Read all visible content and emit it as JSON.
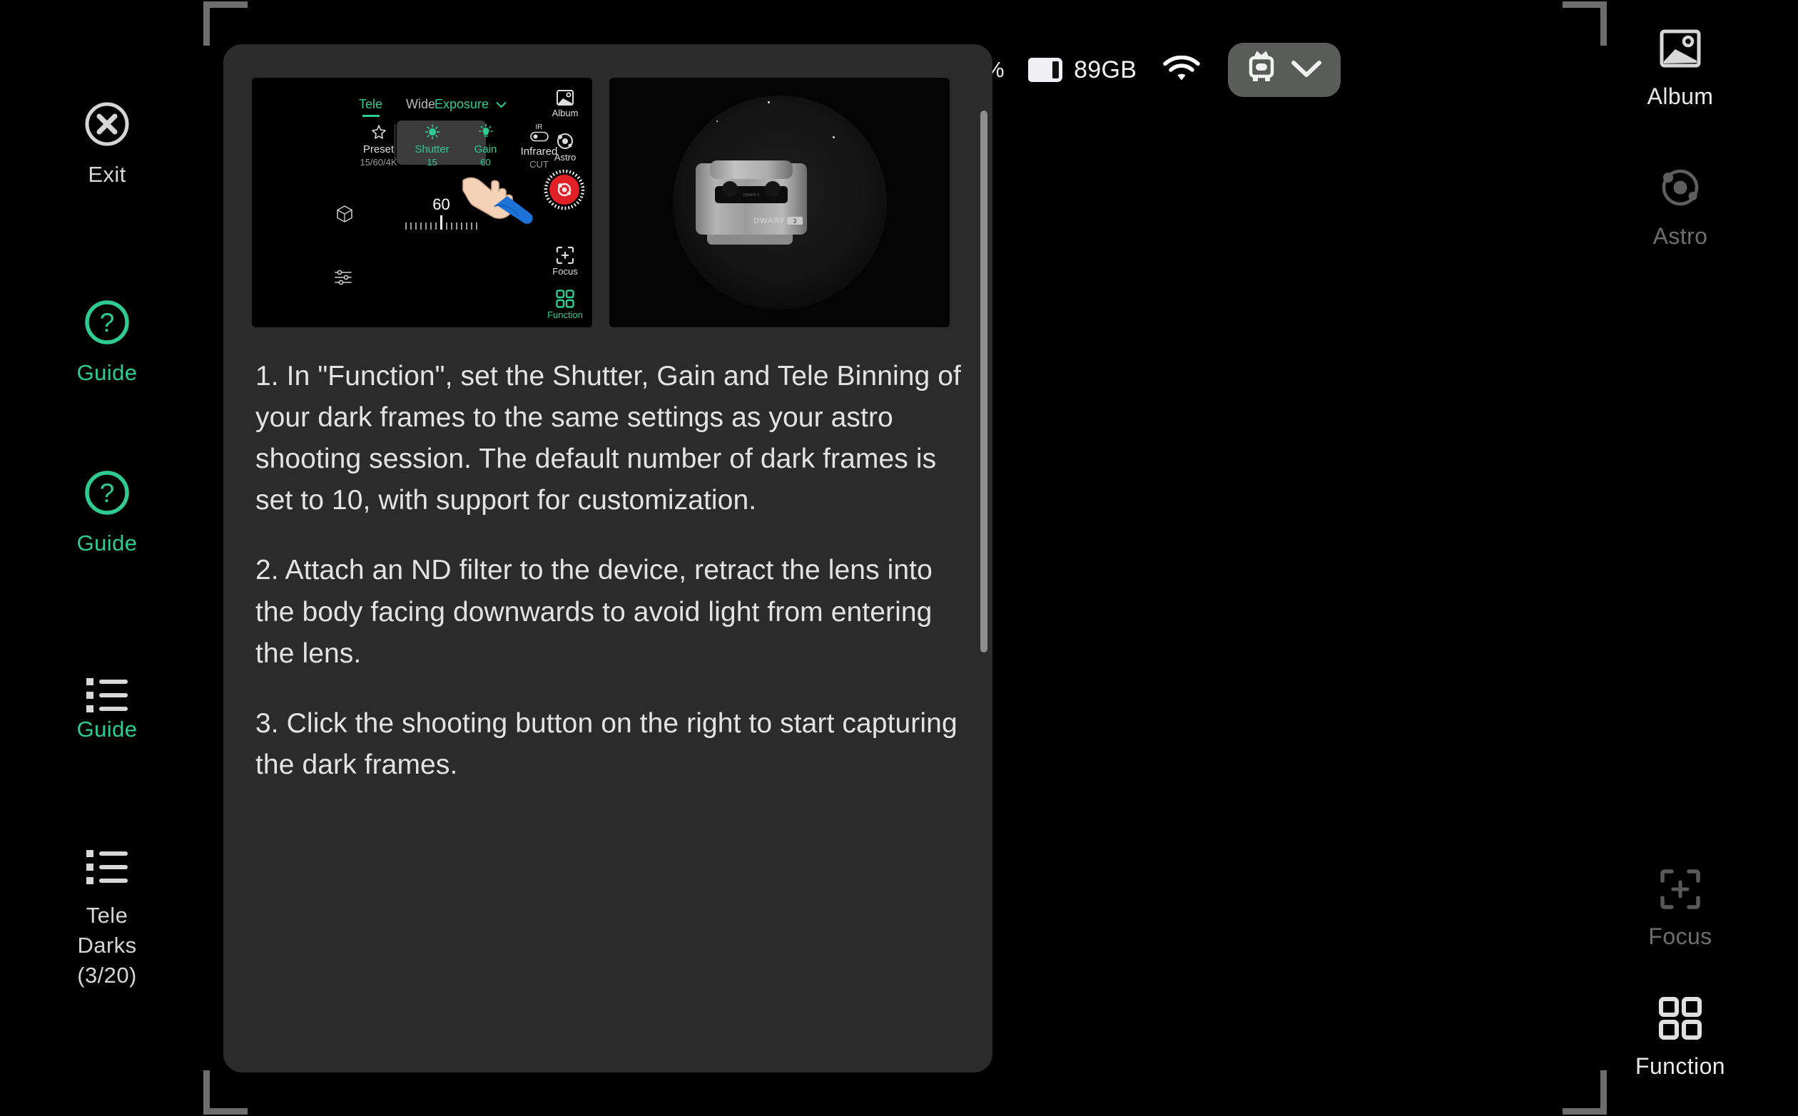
{
  "statusbar": {
    "battery_percent_suffix": "%",
    "storage_icon": "storage-card-icon",
    "storage_free": "89GB",
    "wifi_icon": "wifi-icon",
    "device_icon": "robot-crown-icon",
    "device_chevron_icon": "chevron-down-icon"
  },
  "left_sidebar": {
    "items": [
      {
        "label": "Exit",
        "icon": "close-circle-icon",
        "style": "white"
      },
      {
        "label": "Guide",
        "icon": "question-circle-icon",
        "style": "green"
      },
      {
        "label": "Guide",
        "icon": "question-circle-icon",
        "style": "green"
      },
      {
        "label": "Guide",
        "icon": "list-icon",
        "style": "green"
      },
      {
        "label": "Tele\nDarks\n(3/20)",
        "label_line1": "Tele",
        "label_line2": "Darks",
        "label_line3": "(3/20)",
        "icon": "list-icon",
        "style": "white"
      }
    ]
  },
  "right_sidebar": {
    "album": {
      "label": "Album",
      "icon": "image-icon",
      "state": "bright"
    },
    "astro": {
      "label": "Astro",
      "icon": "astro-orbit-icon",
      "state": "dim"
    },
    "shutter": {
      "icon": "astro-shutter-icon",
      "color": "#e01f26",
      "ring": "dashed-ring"
    },
    "focus": {
      "label": "Focus",
      "icon": "focus-frame-plus-icon",
      "state": "dim"
    },
    "function": {
      "label": "Function",
      "icon": "grid-four-squares-icon",
      "state": "bright"
    }
  },
  "dialog": {
    "thumbnails": [
      {
        "name": "ui-mock-thumbnail",
        "tabs": [
          {
            "label": "Tele",
            "active": true
          },
          {
            "label": "Wide",
            "active": false
          }
        ],
        "exposure_label": "Exposure",
        "controls": [
          {
            "name": "Preset",
            "value": "15/60/4K",
            "highlighted": false
          },
          {
            "name": "Shutter",
            "value": "15",
            "highlighted": true
          },
          {
            "name": "Gain",
            "value": "60",
            "highlighted": true
          },
          {
            "name": "Infrared",
            "value": "CUT",
            "highlighted": false
          }
        ],
        "slider_value": "60",
        "side_buttons": [
          {
            "label": "Album",
            "active": false
          },
          {
            "label": "Astro",
            "active": false
          },
          {
            "label": "Focus",
            "active": false
          },
          {
            "label": "Function",
            "active": true
          }
        ]
      },
      {
        "name": "device-photo-thumbnail",
        "device_brand": "DWARF 3"
      }
    ],
    "paragraphs": [
      "1. In \"Function\", set the Shutter, Gain and Tele Binning of your dark frames to the same settings as your astro shooting session. The default number of dark frames is set to 10, with support for customization.",
      "2. Attach an ND filter to the device, retract the lens into the body facing downwards to avoid light from entering the lens.",
      "3. Click the shooting button on the right to start capturing the dark frames."
    ]
  },
  "colors": {
    "accent_green": "#2ecb93",
    "shutter_red": "#e01f26",
    "dialog_bg": "#2b2b2b",
    "text_primary": "#e3e3e3"
  }
}
